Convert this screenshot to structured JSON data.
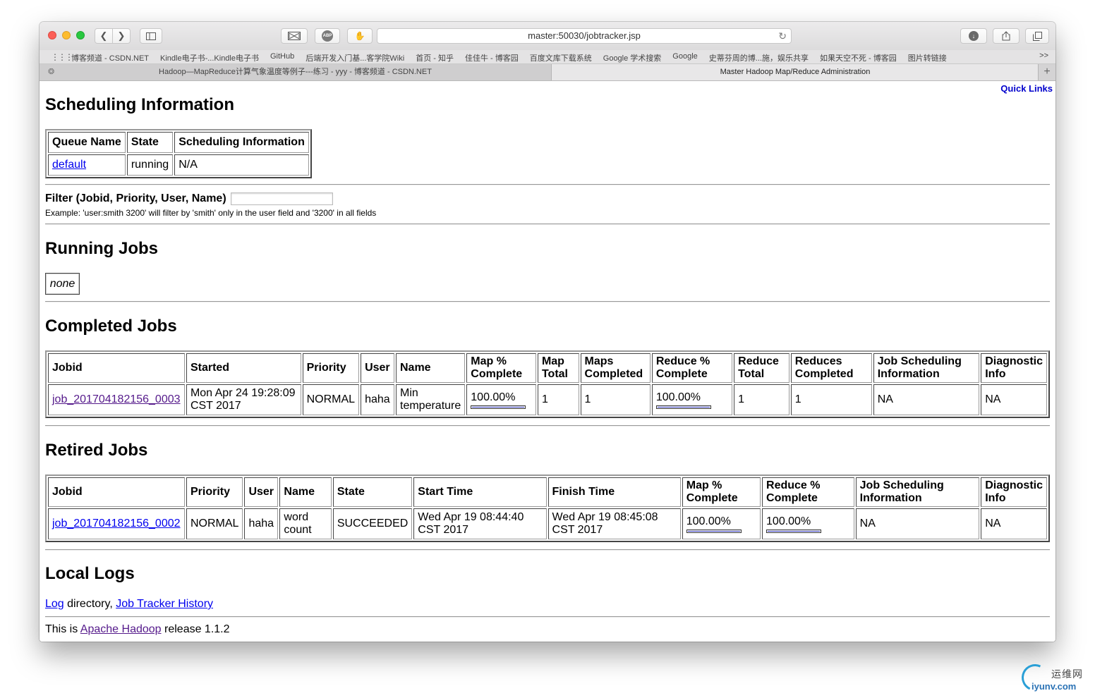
{
  "browser": {
    "url": "master:50030/jobtracker.jsp",
    "bookmarks": [
      "博客频道 - CSDN.NET",
      "Kindle电子书-...Kindle电子书",
      "GitHub",
      "后端开发入门基...客学院Wiki",
      "首页 - 知乎",
      "佳佳牛 - 博客园",
      "百度文库下载系统",
      "Google 学术搜索",
      "Google",
      "史蒂芬周的博...施，娱乐共享",
      "如果天空不死 - 博客园",
      "图片转链接"
    ],
    "bookmarks_more": ">>",
    "tabs": [
      {
        "title": "Hadoop—MapReduce计算气象温度等例子---练习 - yyy - 博客频道 - CSDN.NET"
      },
      {
        "title": "Master Hadoop Map/Reduce Administration"
      }
    ],
    "new_tab": "+"
  },
  "page": {
    "quick_links": "Quick Links",
    "scheduling": {
      "title": "Scheduling Information",
      "headers": [
        "Queue Name",
        "State",
        "Scheduling Information"
      ],
      "row": {
        "queue": "default",
        "state": "running",
        "info": "N/A"
      }
    },
    "filter": {
      "label": "Filter (Jobid, Priority, User, Name)",
      "value": "",
      "example": "Example: 'user:smith 3200' will filter by 'smith' only in the user field and '3200' in all fields"
    },
    "running": {
      "title": "Running Jobs",
      "none": "none"
    },
    "completed": {
      "title": "Completed Jobs",
      "headers": [
        "Jobid",
        "Started",
        "Priority",
        "User",
        "Name",
        "Map % Complete",
        "Map Total",
        "Maps Completed",
        "Reduce % Complete",
        "Reduce Total",
        "Reduces Completed",
        "Job Scheduling Information",
        "Diagnostic Info"
      ],
      "row": {
        "jobid": "job_201704182156_0003",
        "started": "Mon Apr 24 19:28:09 CST 2017",
        "priority": "NORMAL",
        "user": "haha",
        "name": "Min temperature",
        "map_pct": "100.00%",
        "map_total": "1",
        "maps_completed": "1",
        "reduce_pct": "100.00%",
        "reduce_total": "1",
        "reduces_completed": "1",
        "sched_info": "NA",
        "diag_info": "NA"
      },
      "map_progress": 1.0,
      "reduce_progress": 1.0
    },
    "retired": {
      "title": "Retired Jobs",
      "headers": [
        "Jobid",
        "Priority",
        "User",
        "Name",
        "State",
        "Start Time",
        "Finish Time",
        "Map % Complete",
        "Reduce % Complete",
        "Job Scheduling Information",
        "Diagnostic Info"
      ],
      "row": {
        "jobid": "job_201704182156_0002",
        "priority": "NORMAL",
        "user": "haha",
        "name": "word count",
        "state": "SUCCEEDED",
        "start_time": "Wed Apr 19 08:44:40 CST 2017",
        "finish_time": "Wed Apr 19 08:45:08 CST 2017",
        "map_pct": "100.00%",
        "reduce_pct": "100.00%",
        "sched_info": "NA",
        "diag_info": "NA"
      },
      "map_progress": 1.0,
      "reduce_progress": 1.0
    },
    "local_logs": {
      "title": "Local Logs",
      "log_link": "Log",
      "directory_text": " directory, ",
      "history_link": "Job Tracker History"
    },
    "release": {
      "prefix": "This is ",
      "link": "Apache Hadoop",
      "suffix": " release 1.1.2"
    }
  },
  "watermark": {
    "cn": "运维网",
    "en": "iyunv.com"
  },
  "colors": {
    "link": "#0000ee",
    "visited": "#551a8b",
    "progress": "#3f44c7",
    "quick_links": "#0000cc"
  }
}
